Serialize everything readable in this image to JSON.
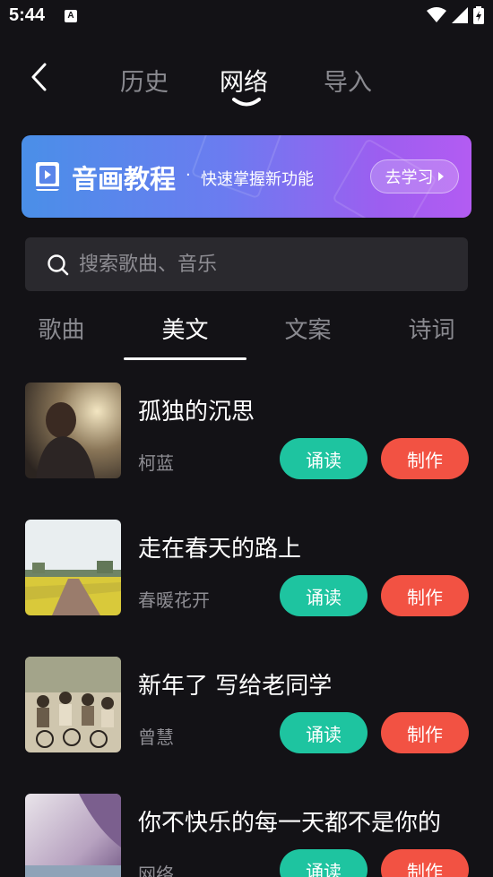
{
  "status": {
    "time": "5:44",
    "notif_letter": "A"
  },
  "nav": {
    "tabs": [
      {
        "label": "历史"
      },
      {
        "label": "网络"
      },
      {
        "label": "导入"
      }
    ]
  },
  "banner": {
    "title": "音画教程",
    "separator": "·",
    "subtitle": "快速掌握新功能",
    "button": "去学习"
  },
  "search": {
    "placeholder": "搜索歌曲、音乐"
  },
  "categories": [
    {
      "label": "歌曲"
    },
    {
      "label": "美文"
    },
    {
      "label": "文案"
    },
    {
      "label": "诗词"
    }
  ],
  "items": [
    {
      "title": "孤独的沉思",
      "author": "柯蓝",
      "read_label": "诵读",
      "make_label": "制作"
    },
    {
      "title": "走在春天的路上",
      "author": "春暖花开",
      "read_label": "诵读",
      "make_label": "制作"
    },
    {
      "title": "新年了 写给老同学",
      "author": "曾慧",
      "read_label": "诵读",
      "make_label": "制作"
    },
    {
      "title": "你不快乐的每一天都不是你的",
      "author": "网络",
      "read_label": "诵读",
      "make_label": "制作"
    }
  ],
  "colors": {
    "background": "#131216",
    "read": "#1ec4a0",
    "make": "#f25243",
    "banner_start": "#4a8fe8",
    "banner_end": "#b35cf2"
  }
}
